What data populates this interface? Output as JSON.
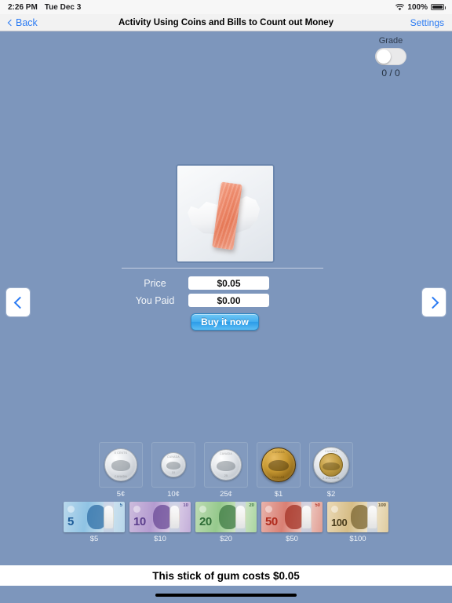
{
  "status_bar": {
    "time": "2:26 PM",
    "date": "Tue Dec 3",
    "battery_percent": "100%",
    "wifi_icon": "wifi-icon",
    "battery_icon": "battery-icon"
  },
  "nav_bar": {
    "back_label": "Back",
    "title": "Activity Using Coins and Bills to Count out Money",
    "settings_label": "Settings"
  },
  "grade": {
    "label": "Grade",
    "toggle_state": "off",
    "score": "0 / 0"
  },
  "navigation": {
    "prev_icon": "chevron-left-icon",
    "next_icon": "chevron-right-icon"
  },
  "product": {
    "image_alt": "stick-of-gum-image"
  },
  "purchase": {
    "price_label": "Price",
    "price_value": "$0.05",
    "paid_label": "You Paid",
    "paid_value": "$0.00",
    "buy_label": "Buy it now"
  },
  "coins": [
    {
      "label": "5¢",
      "name": "coin-5-cents",
      "top_text": "5 CENTS",
      "bottom_text": "CANADA"
    },
    {
      "label": "10¢",
      "name": "coin-10-cents",
      "top_text": "CANADA",
      "bottom_text": "10"
    },
    {
      "label": "25¢",
      "name": "coin-25-cents",
      "top_text": "CANADA",
      "bottom_text": "25"
    },
    {
      "label": "$1",
      "name": "coin-1-dollar",
      "top_text": "CANADA",
      "bottom_text": "DOLLAR"
    },
    {
      "label": "$2",
      "name": "coin-2-dollars",
      "top_text": "CANADA",
      "bottom_text": "2 DOLLARS"
    }
  ],
  "bills": [
    {
      "label": "$5",
      "denom": "5",
      "name": "bill-5-dollars"
    },
    {
      "label": "$10",
      "denom": "10",
      "name": "bill-10-dollars"
    },
    {
      "label": "$20",
      "denom": "20",
      "name": "bill-20-dollars"
    },
    {
      "label": "$50",
      "denom": "50",
      "name": "bill-50-dollars"
    },
    {
      "label": "$100",
      "denom": "100",
      "name": "bill-100-dollars"
    }
  ],
  "prompt": {
    "text": "This stick of gum costs $0.05"
  },
  "colors": {
    "background": "#7d96bc",
    "accent_blue": "#2b7bf3",
    "nav_bar": "#f2f2f2",
    "button_blue": "#45aef0"
  }
}
